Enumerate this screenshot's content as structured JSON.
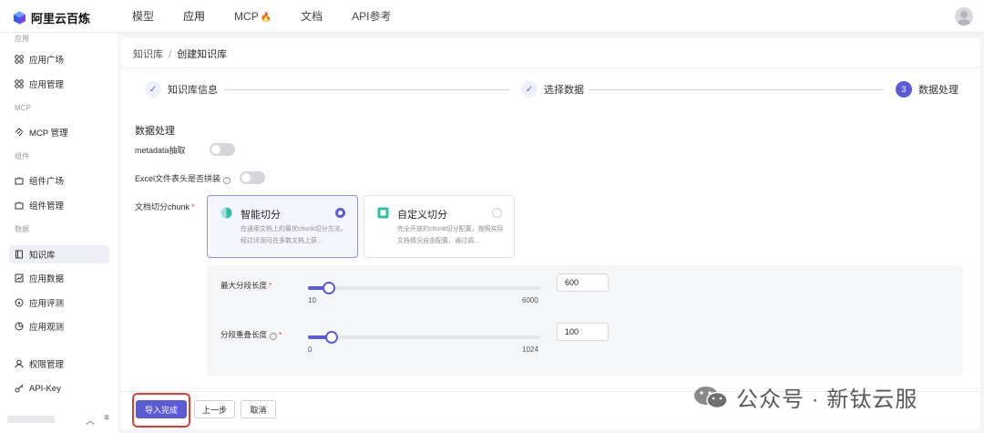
{
  "app": {
    "title": "阿里云百炼"
  },
  "nav": {
    "items": [
      "模型",
      "应用",
      "MCP",
      "文档",
      "API参考"
    ]
  },
  "sidebar": {
    "groups": {
      "app": "应用",
      "mcp": "MCP",
      "component": "组件",
      "data": "数据"
    },
    "items": {
      "app_square": "应用广场",
      "app_manage": "应用管理",
      "mcp_manage": "MCP 管理",
      "comp_square": "组件广场",
      "comp_manage": "组件管理",
      "kb": "知识库",
      "app_data": "应用数据",
      "app_eval": "应用评测",
      "app_observe": "应用观测",
      "perm": "权限管理",
      "apikey": "API-Key"
    },
    "active": "知识库"
  },
  "breadcrumb": {
    "parent": "知识库",
    "sep": "/",
    "current": "创建知识库"
  },
  "steps": [
    {
      "label": "知识库信息",
      "marker": "✓"
    },
    {
      "label": "选择数据",
      "marker": "✓"
    },
    {
      "label": "数据处理",
      "marker": "3"
    }
  ],
  "form": {
    "section_title": "数据处理",
    "metadata_label": "metadata抽取",
    "excel_label": "Excel文件表头是否拼装",
    "chunk_label": "文档切分chunk",
    "metadata_enabled": false,
    "excel_enabled": false
  },
  "chunk_options": [
    {
      "title": "智能切分",
      "desc": "在通用文档上的最优chunk切分方法，经过评测可在多数文档上获...",
      "selected": true
    },
    {
      "title": "自定义切分",
      "desc": "完全开放的chunk切分配置，按照实际文档情况自由配置，通过调...",
      "selected": false
    }
  ],
  "params": {
    "max_len": {
      "label": "最大分段长度",
      "min": "10",
      "max": "6000",
      "value": "600",
      "fraction": 0.09
    },
    "overlap": {
      "label": "分段重叠长度",
      "min": "0",
      "max": "1024",
      "value": "100",
      "fraction": 0.1
    }
  },
  "buttons": {
    "submit": "导入完成",
    "prev": "上一步",
    "cancel": "取消"
  },
  "watermark": {
    "text": "公众号 · 新钛云服"
  },
  "colors": {
    "primary": "#5b5bd6",
    "highlight": "#e53a3a",
    "required": "#e04848"
  }
}
